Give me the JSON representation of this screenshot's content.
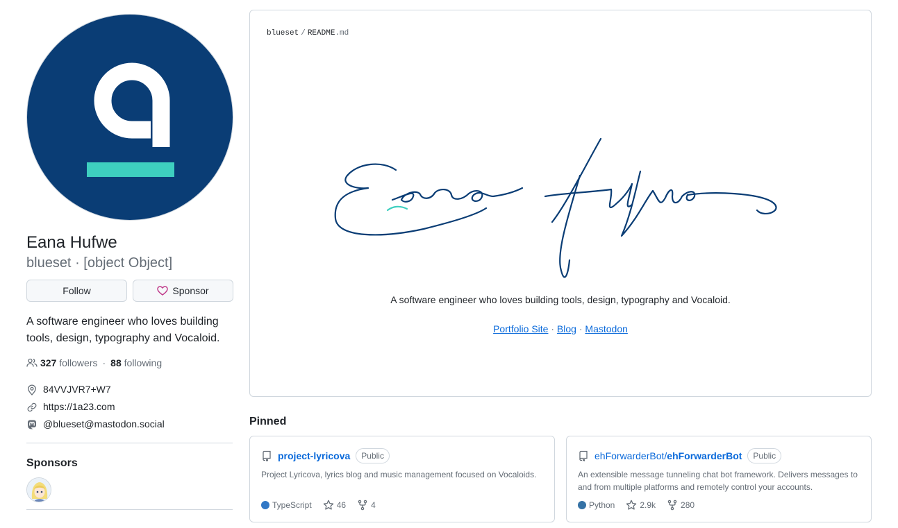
{
  "profile": {
    "name": "Eana Hufwe",
    "username": "blueset",
    "pronouns": "[object Object]",
    "separator": "·",
    "follow_label": "Follow",
    "sponsor_label": "Sponsor",
    "bio": "A software engineer who loves building tools, design, typography and Vocaloid.",
    "followers_count": "327",
    "followers_label": "followers",
    "following_count": "88",
    "following_label": "following",
    "location": "84VVJVR7+W7",
    "website": "https://1a23.com",
    "mastodon": "@blueset@mastodon.social",
    "sponsors_title": "Sponsors",
    "icons": {
      "avatar_bg": "#0a3d75",
      "avatar_letter": "#ffffff",
      "avatar_bar": "#3ecfbf"
    }
  },
  "readme": {
    "repo": "blueset",
    "separator": "/",
    "file_base": "README",
    "file_ext": ".md",
    "signature_color": "#0a3d75",
    "accent_color": "#3ecfbf",
    "tagline": "A software engineer who loves building tools, design, typography and Vocaloid.",
    "links": [
      {
        "label": "Portfolio Site"
      },
      {
        "label": "Blog"
      },
      {
        "label": "Mastodon"
      }
    ],
    "link_separator": "·"
  },
  "pinned": {
    "title": "Pinned",
    "repos": [
      {
        "owner": "",
        "name": "project-lyricova",
        "visibility": "Public",
        "description": "Project Lyricova, lyrics blog and music management focused on Vocaloids.",
        "language": "TypeScript",
        "language_color": "#3178c6",
        "stars": "46",
        "forks": "4"
      },
      {
        "owner": "ehForwarderBot/",
        "name": "ehForwarderBot",
        "visibility": "Public",
        "description": "An extensible message tunneling chat bot framework. Delivers messages to and from multiple platforms and remotely control your accounts.",
        "language": "Python",
        "language_color": "#3572A5",
        "stars": "2.9k",
        "forks": "280"
      }
    ]
  }
}
